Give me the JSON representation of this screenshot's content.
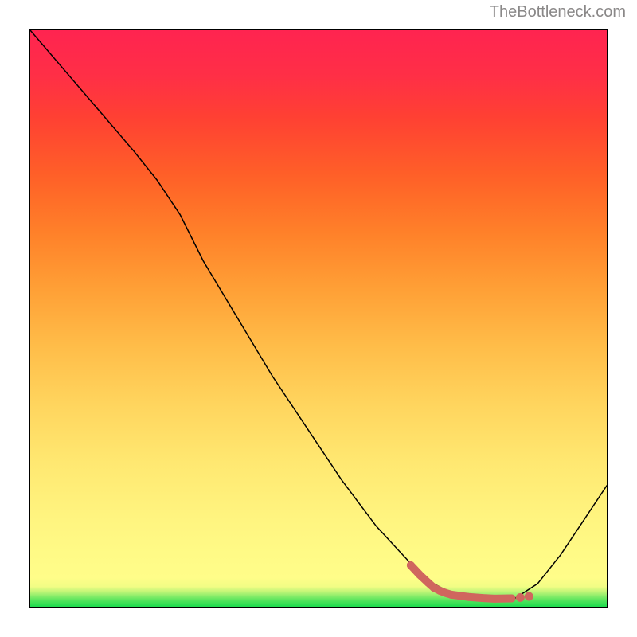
{
  "watermark": "TheBottleneck.com",
  "chart_data": {
    "type": "line",
    "title": "",
    "xlabel": "",
    "ylabel": "",
    "xlim": [
      0,
      100
    ],
    "ylim": [
      0,
      100
    ],
    "series": [
      {
        "name": "curve",
        "color": "#000000",
        "thickness": 1.5,
        "x": [
          0,
          6,
          12,
          18,
          22,
          26,
          30,
          36,
          42,
          48,
          54,
          60,
          66,
          70,
          73,
          76,
          80,
          84,
          88,
          92,
          96,
          100
        ],
        "y": [
          100,
          93,
          86,
          79,
          74,
          68,
          60,
          50,
          40,
          31,
          22,
          14,
          7.5,
          4,
          2.4,
          1.6,
          1.2,
          1.4,
          4,
          9,
          15,
          21
        ]
      },
      {
        "name": "highlight-dots",
        "color": "#d0665e",
        "thickness": 10,
        "style": "thick",
        "x": [
          66,
          67.5,
          69,
          70,
          71,
          72,
          73,
          74.5,
          76,
          78.5,
          80.5,
          83.5
        ],
        "y": [
          7.2,
          5.6,
          4.2,
          3.3,
          2.8,
          2.4,
          2.1,
          1.9,
          1.7,
          1.5,
          1.4,
          1.45
        ]
      },
      {
        "name": "highlight-dots-extra",
        "color": "#d0665e",
        "style": "dots",
        "x": [
          85,
          86.5
        ],
        "y": [
          1.6,
          1.8
        ]
      }
    ]
  }
}
